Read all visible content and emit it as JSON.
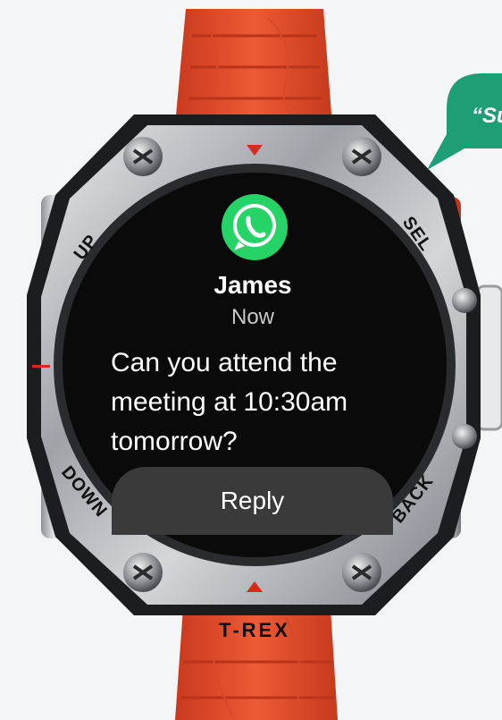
{
  "notification": {
    "app_icon": "whatsapp-icon",
    "sender": "James",
    "time": "Now",
    "message": "Can you attend the meeting at 10:30am tomorrow?",
    "reply_label": "Reply"
  },
  "bezel": {
    "up": "UP",
    "down": "DOWN",
    "sel": "SEL",
    "back": "BACK"
  },
  "brand": "T-REX",
  "speech_bubble": {
    "text": "“Su"
  },
  "colors": {
    "strap": "#e5502f",
    "whatsapp": "#25d366",
    "bubble": "#1e9e76",
    "screen": "#000000",
    "reply_button": "#3a3a3a"
  }
}
